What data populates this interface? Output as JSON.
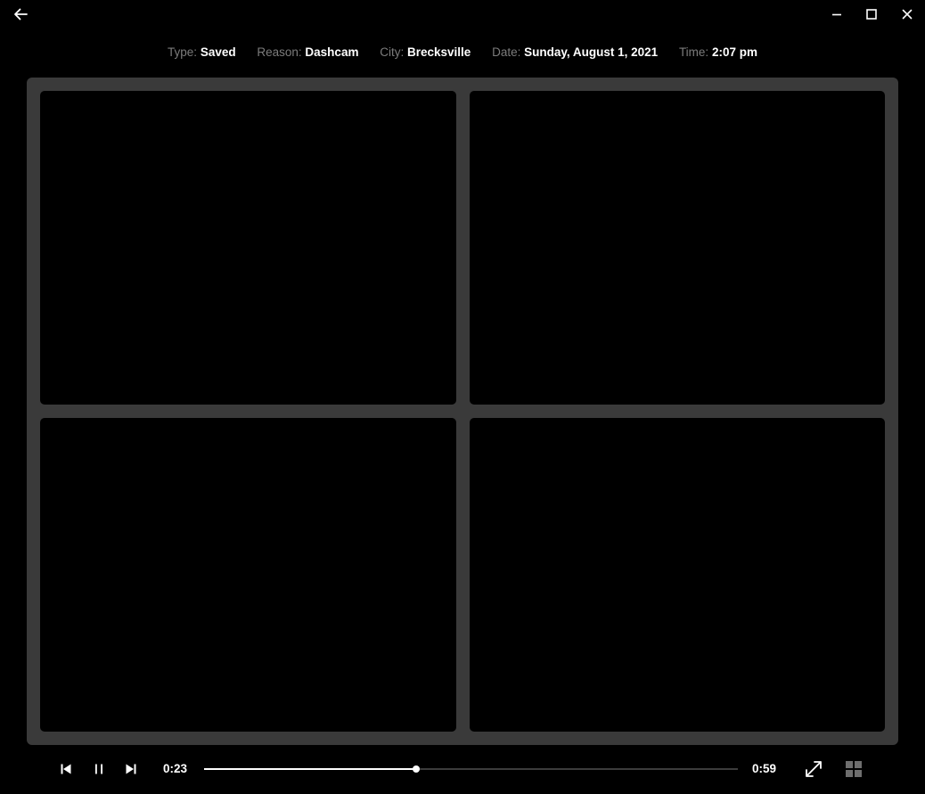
{
  "window": {
    "back_icon": "arrow-left-icon",
    "minimize_icon": "minimize-icon",
    "maximize_icon": "maximize-icon",
    "close_icon": "close-icon"
  },
  "meta": {
    "type_label": "Type:",
    "type_value": "Saved",
    "reason_label": "Reason:",
    "reason_value": "Dashcam",
    "city_label": "City:",
    "city_value": "Brecksville",
    "date_label": "Date:",
    "date_value": "Sunday, August 1, 2021",
    "time_label": "Time:",
    "time_value": "2:07 pm"
  },
  "viewer": {
    "cameras": 4,
    "frame_color": "#3a3a3a"
  },
  "playback": {
    "current_time": "0:23",
    "total_time": "0:59",
    "progress": 0.397,
    "state": "playing",
    "prev_icon": "skip-previous-icon",
    "pause_icon": "pause-icon",
    "next_icon": "skip-next-icon",
    "fullscreen_icon": "expand-icon",
    "layout_icon": "grid-layout-icon"
  },
  "colors": {
    "background": "#000000",
    "label": "#7c7c7c",
    "value": "#ffffff",
    "track": "#3c3c3c",
    "grid_icon": "#6e6e6e"
  }
}
